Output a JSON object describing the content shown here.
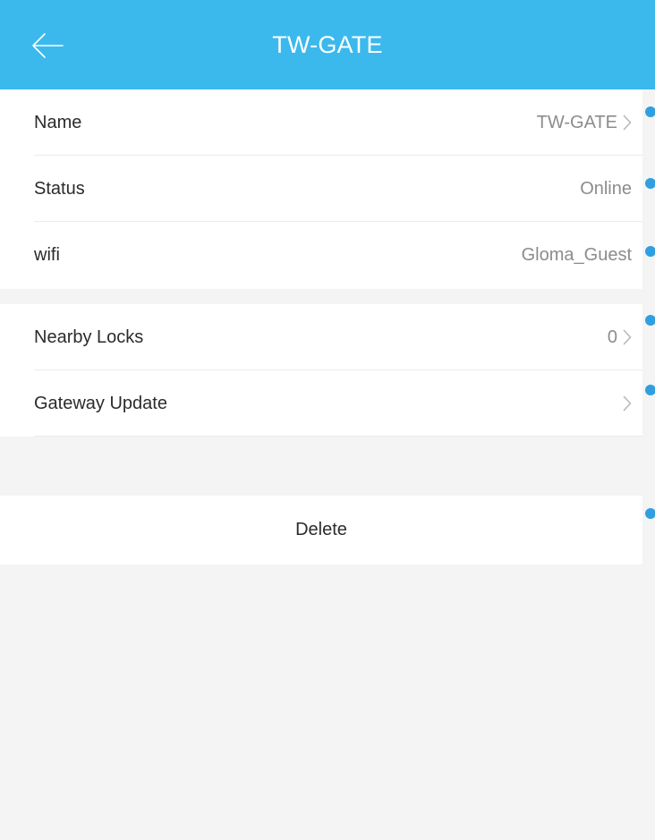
{
  "header": {
    "title": "TW-GATE",
    "background": "#3bb9ed",
    "back_icon": "arrow-left-icon"
  },
  "info": {
    "name": {
      "label": "Name",
      "value": "TW-GATE"
    },
    "status": {
      "label": "Status",
      "value": "Online"
    },
    "wifi": {
      "label": "wifi",
      "value": "Gloma_Guest"
    }
  },
  "settings": {
    "nearby_locks": {
      "label": "Nearby Locks",
      "value": "0"
    },
    "gateway_update": {
      "label": "Gateway Update",
      "value": ""
    }
  },
  "actions": {
    "delete_label": "Delete"
  },
  "colors": {
    "accent": "#3bb9ed",
    "edge_dot": "#2f9fe0",
    "text_primary": "#2b2b2b",
    "text_secondary": "#8c8c8c",
    "background": "#f4f4f4"
  }
}
